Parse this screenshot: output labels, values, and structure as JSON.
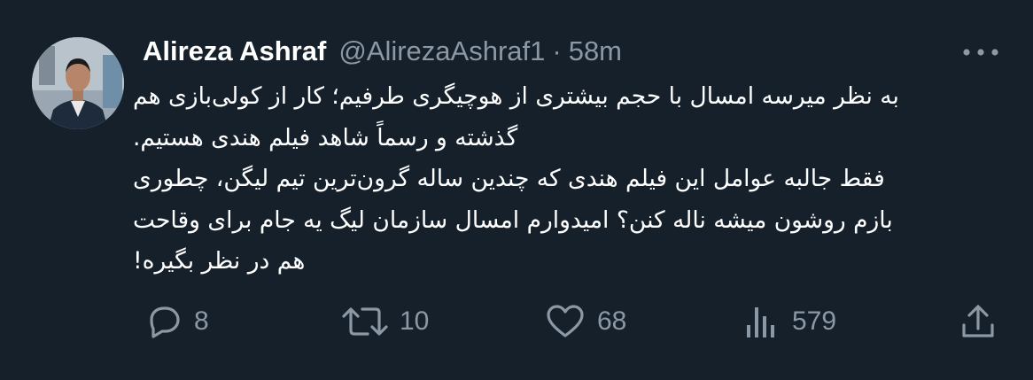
{
  "tweet": {
    "author_name": "Alireza Ashraf",
    "author_handle": "@AlirezaAshraf1",
    "separator": "·",
    "time": "58m",
    "text": "به نظر میرسه امسال با حجم بیشتری از هوچیگری طرفیم؛ کار از کولی‌بازی هم گذشته و رسماً شاهد فیلم هندی هستیم.\nفقط جالبه عوامل این فیلم هندی که چندین ساله گرون‌ترین تیم لیگن، چطوری بازم روشون میشه ناله کنن؟ امیدوارم امسال سازمان لیگ یه جام برای وقاحت هم در نظر بگیره!"
  },
  "actions": {
    "replies": "8",
    "retweets": "10",
    "likes": "68",
    "views": "579"
  },
  "icons": {
    "reply": "reply-icon",
    "retweet": "retweet-icon",
    "like": "heart-icon",
    "views": "views-icon",
    "share": "share-icon",
    "more": "more-icon"
  },
  "colors": {
    "background": "#15202b",
    "text_primary": "#ffffff",
    "text_secondary": "#8b98a5"
  }
}
